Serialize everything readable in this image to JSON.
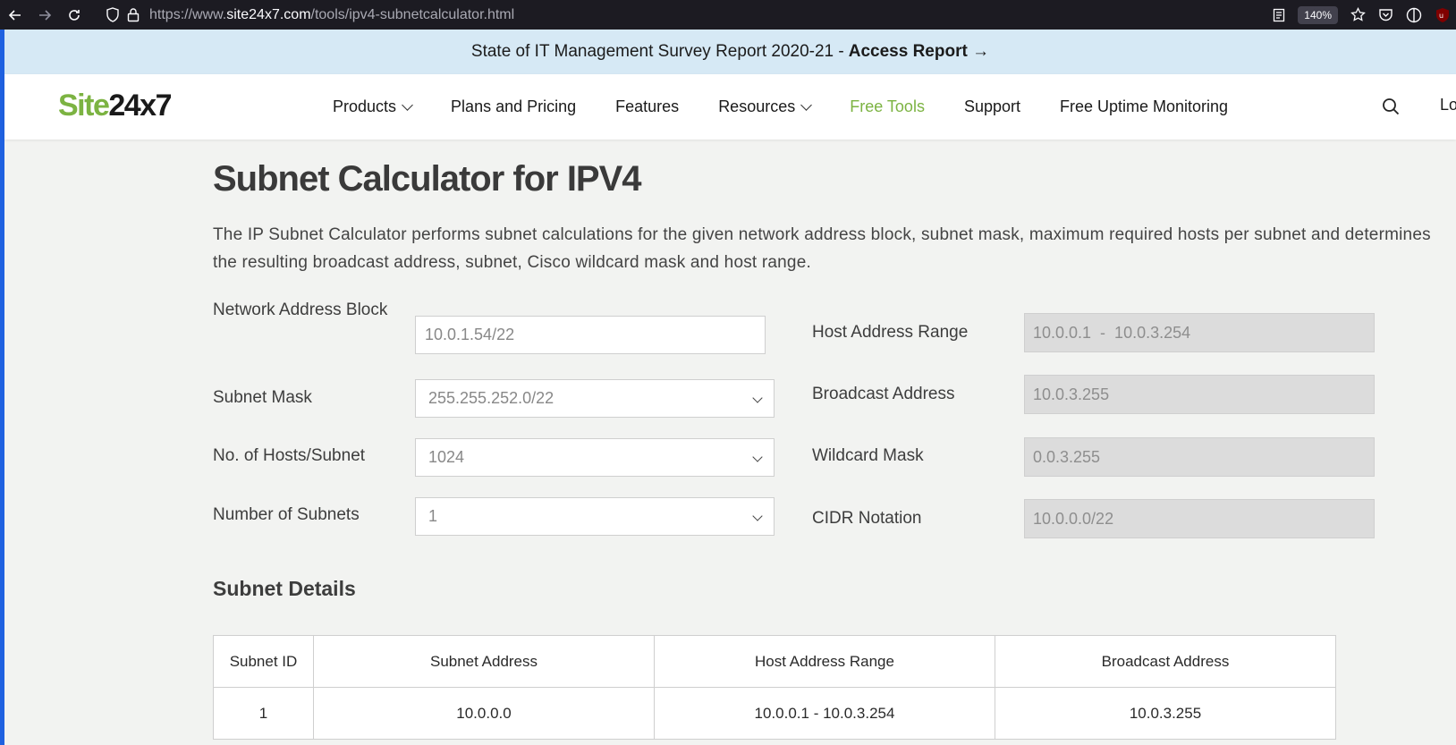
{
  "browser": {
    "url_prefix": "https://www.",
    "url_host": "site24x7.com",
    "url_path": "/tools/ipv4-subnetcalculator.html",
    "zoom": "140%"
  },
  "banner": {
    "text": "State of IT Management Survey Report 2020-21 -",
    "link": "Access Report →"
  },
  "header": {
    "logo_site": "Site",
    "logo_num": "24x7",
    "nav": {
      "products": "Products",
      "plans": "Plans and Pricing",
      "features": "Features",
      "resources": "Resources",
      "free_tools": "Free Tools",
      "support": "Support",
      "uptime": "Free Uptime Monitoring"
    },
    "login": "Lo"
  },
  "main": {
    "title": "Subnet Calculator for IPV4",
    "description": "The IP Subnet Calculator performs subnet calculations for the given network address block, subnet mask, maximum required hosts per subnet and determines the resulting broadcast address, subnet, Cisco wildcard mask and host range."
  },
  "form": {
    "network_label": "Network Address Block",
    "network_value": "10.0.1.54/22",
    "mask_label": "Subnet Mask",
    "mask_value": "255.255.252.0/22",
    "hosts_label": "No. of Hosts/Subnet",
    "hosts_value": "1024",
    "subnets_label": "Number of Subnets",
    "subnets_value": "1"
  },
  "results": {
    "host_range_label": "Host Address Range",
    "host_range_value": "10.0.0.1  -  10.0.3.254",
    "broadcast_label": "Broadcast Address",
    "broadcast_value": "10.0.3.255",
    "wildcard_label": "Wildcard Mask",
    "wildcard_value": "0.0.3.255",
    "cidr_label": "CIDR Notation",
    "cidr_value": "10.0.0.0/22"
  },
  "details": {
    "title": "Subnet Details",
    "headers": {
      "id": "Subnet ID",
      "address": "Subnet Address",
      "range": "Host Address Range",
      "broadcast": "Broadcast Address"
    },
    "rows": [
      {
        "id": "1",
        "address": "10.0.0.0",
        "range": "10.0.0.1 - 10.0.3.254",
        "broadcast": "10.0.3.255"
      }
    ]
  }
}
